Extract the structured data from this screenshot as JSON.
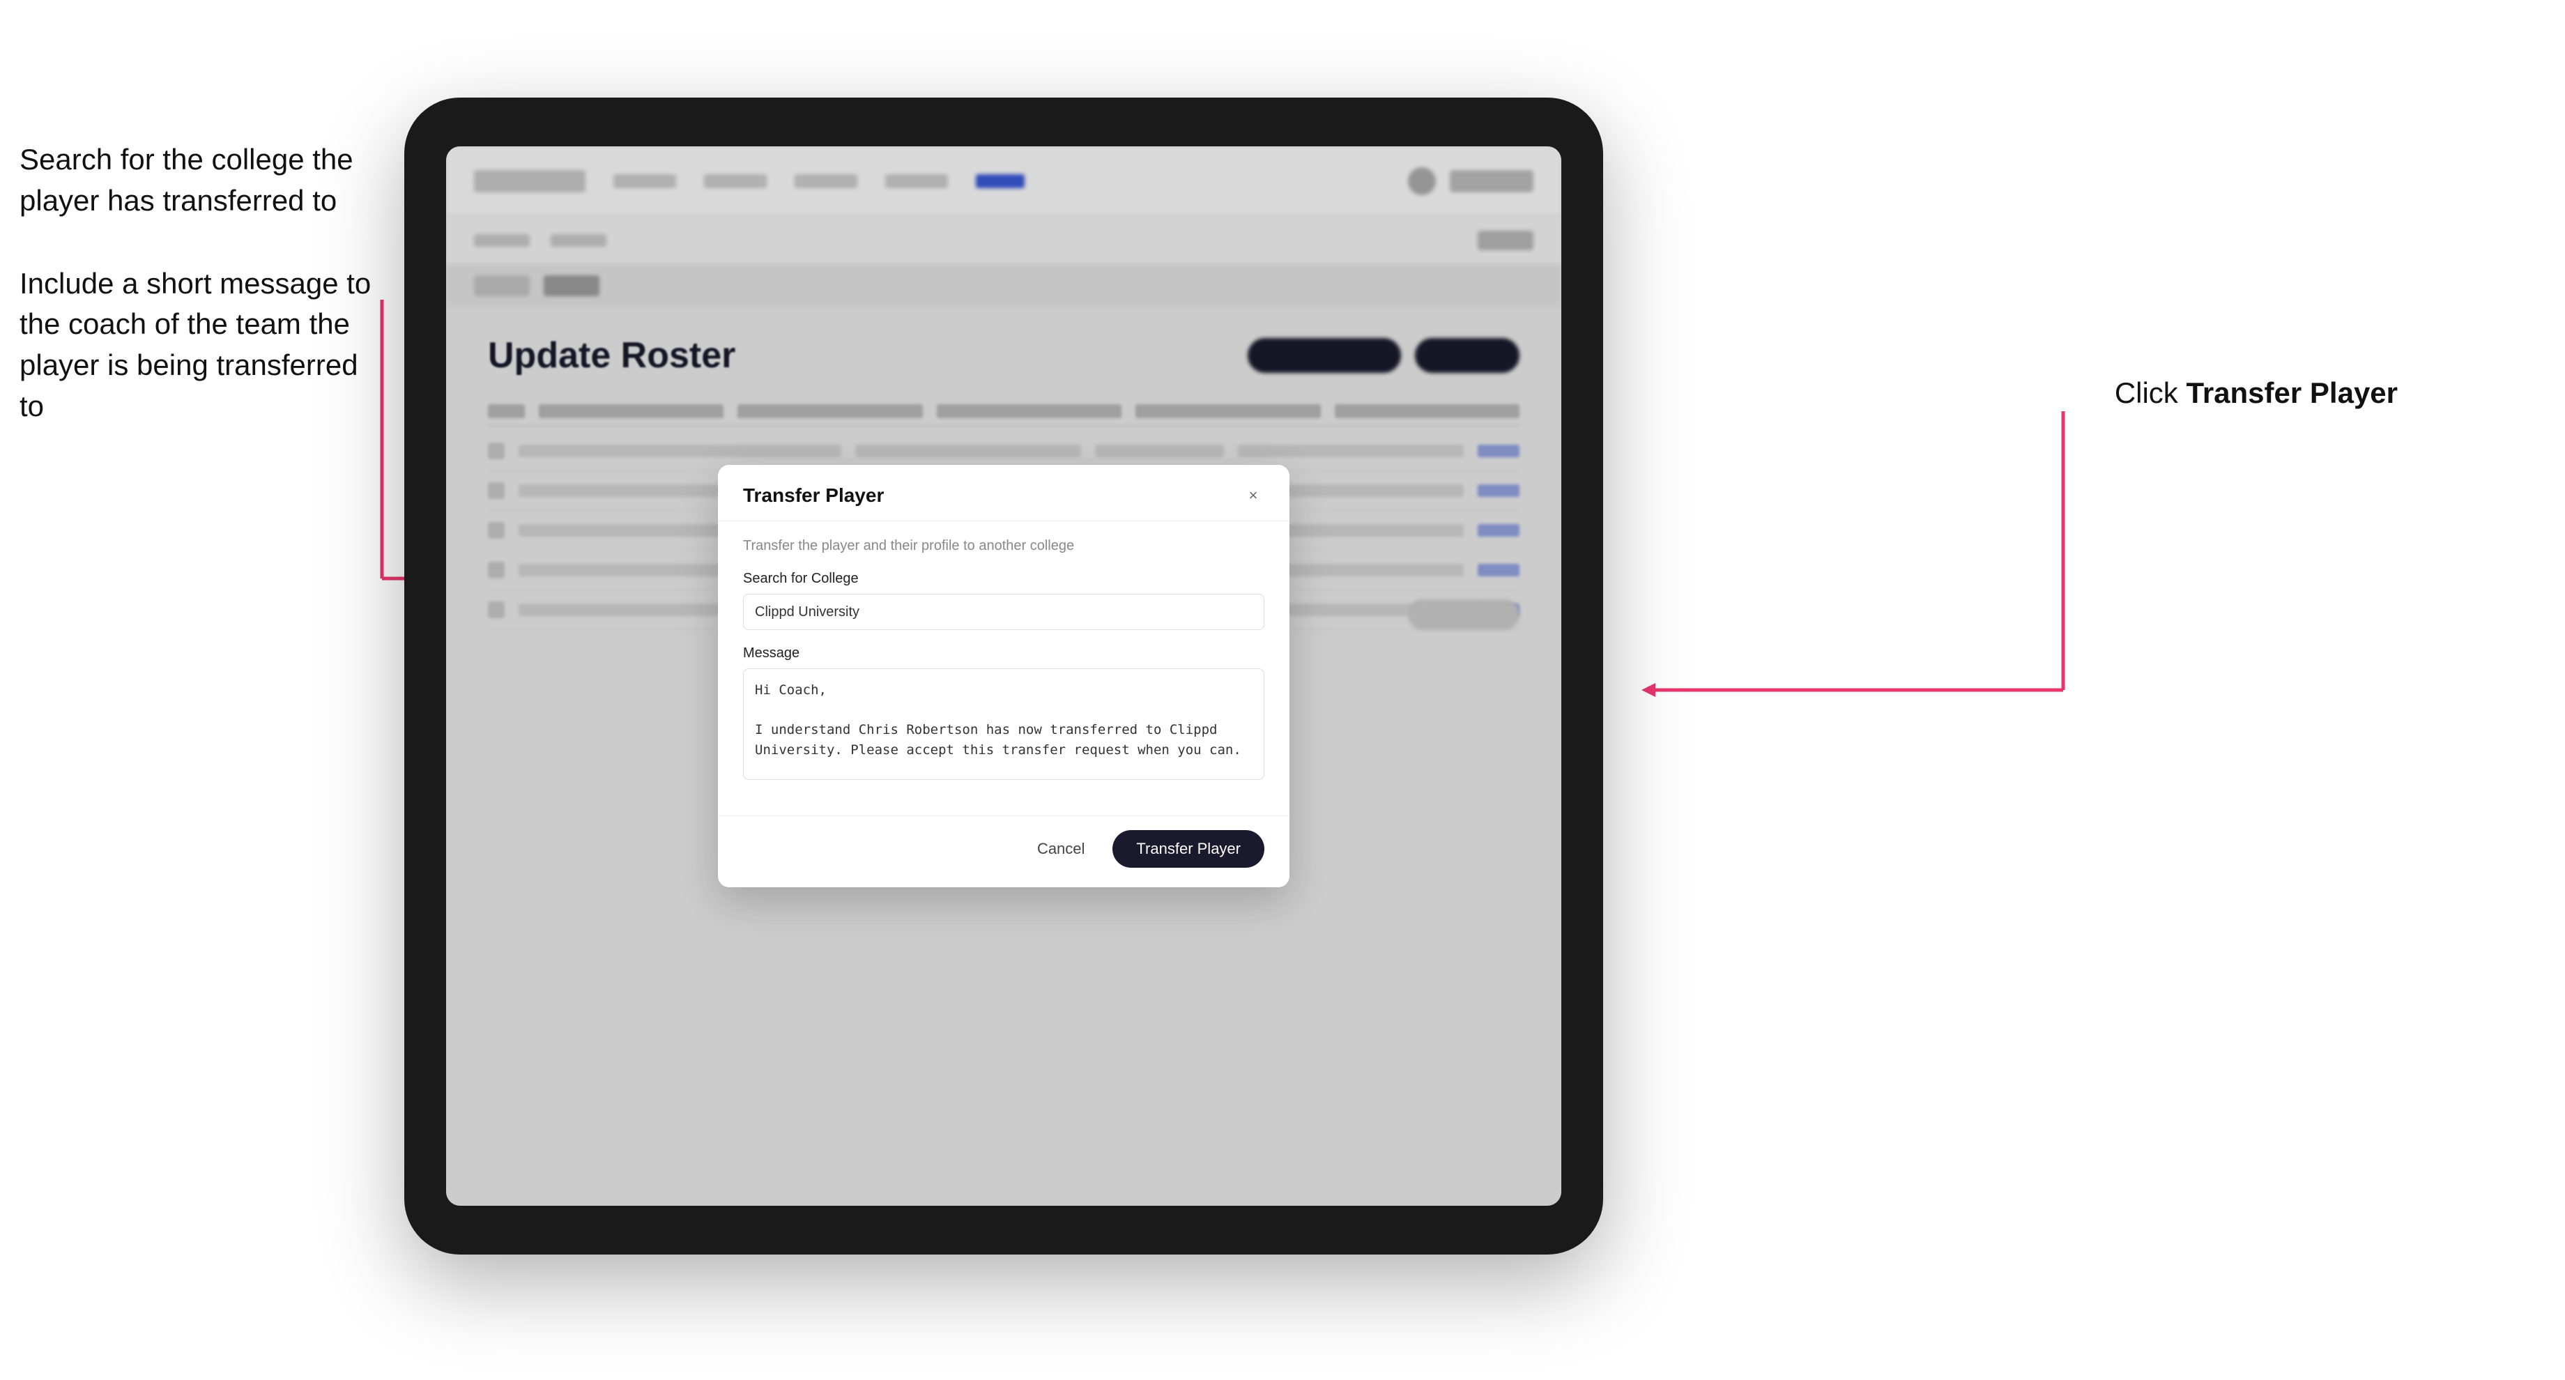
{
  "annotations": {
    "left_top": "Search for the college the player has transferred to",
    "left_bottom": "Include a short message to the coach of the team the player is being transferred to",
    "right": "Click ",
    "right_bold": "Transfer Player"
  },
  "tablet": {
    "page_title": "Update Roster"
  },
  "modal": {
    "title": "Transfer Player",
    "subtitle": "Transfer the player and their profile to another college",
    "search_label": "Search for College",
    "search_value": "Clippd University",
    "search_placeholder": "Search for College",
    "message_label": "Message",
    "message_value": "Hi Coach,\n\nI understand Chris Robertson has now transferred to Clippd University. Please accept this transfer request when you can.",
    "cancel_label": "Cancel",
    "transfer_label": "Transfer Player",
    "close_icon": "×"
  }
}
